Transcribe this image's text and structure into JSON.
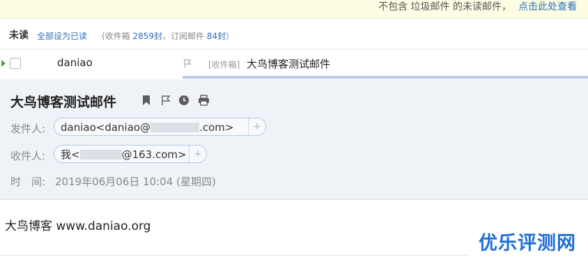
{
  "notice": {
    "text": "不包含 垃圾邮件 的未读邮件，",
    "link": "点击此处查看"
  },
  "unread": {
    "title": "未读",
    "mark_all": "全部设为已读",
    "inbox_prefix": "(收件箱 ",
    "inbox_count": "2859封",
    "sep": "，订阅邮件 ",
    "sub_count": "84封",
    "suffix": "）"
  },
  "mail_row": {
    "sender": "daniao",
    "folder": "[收件箱]",
    "subject": "大鸟博客测试邮件"
  },
  "detail": {
    "subject": "大鸟博客测试邮件",
    "from_label": "发件人:",
    "from_name": "daniao<daniao@",
    "from_domain_end": ".com>",
    "to_label": "收件人:",
    "to_name": "我<",
    "to_domain_end": "@163.com>",
    "time_label": "时　间:",
    "time_value": "2019年06月06日 10:04 (星期四)",
    "plus": "+"
  },
  "body": {
    "text": "大鸟博客 www.daniao.org"
  },
  "watermark": "优乐评测网",
  "colors": {
    "link": "#2c6fb7",
    "accent_green": "#3ea53e",
    "watermark": "#1f6ed4",
    "header_bg": "#eff2f6"
  },
  "icons": [
    "flag-icon",
    "bookmark-icon",
    "flag-outline-icon",
    "clock-icon",
    "print-icon"
  ]
}
